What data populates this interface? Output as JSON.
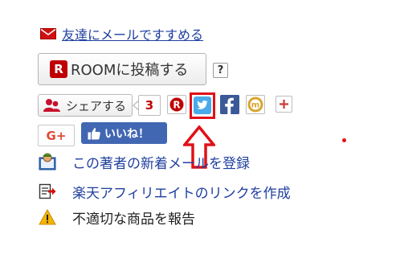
{
  "mail_recommend": {
    "label": "友達にメールですすめる",
    "icon": "mail-icon"
  },
  "room": {
    "badge": "R",
    "label": "ROOMに投稿する",
    "help": "?"
  },
  "share": {
    "label": "シェアする",
    "count": "3"
  },
  "social_icons": [
    "rakuten-icon",
    "twitter-icon",
    "facebook-icon",
    "mixi-icon",
    "plus-icon"
  ],
  "gplus": {
    "label": "G+"
  },
  "like": {
    "label": "いいね！"
  },
  "menu": [
    {
      "label": "この著者の新着メールを登録",
      "icon": "author-icon"
    },
    {
      "label": "楽天アフィリエイトのリンクを作成",
      "icon": "affiliate-link-icon"
    },
    {
      "label": "不適切な商品を報告",
      "icon": "warning-icon"
    }
  ],
  "colors": {
    "link": "#1f3f9f",
    "rakuten_red": "#bf0000",
    "highlight": "#e01018",
    "facebook": "#4267b2",
    "twitter": "#1da1f2"
  }
}
